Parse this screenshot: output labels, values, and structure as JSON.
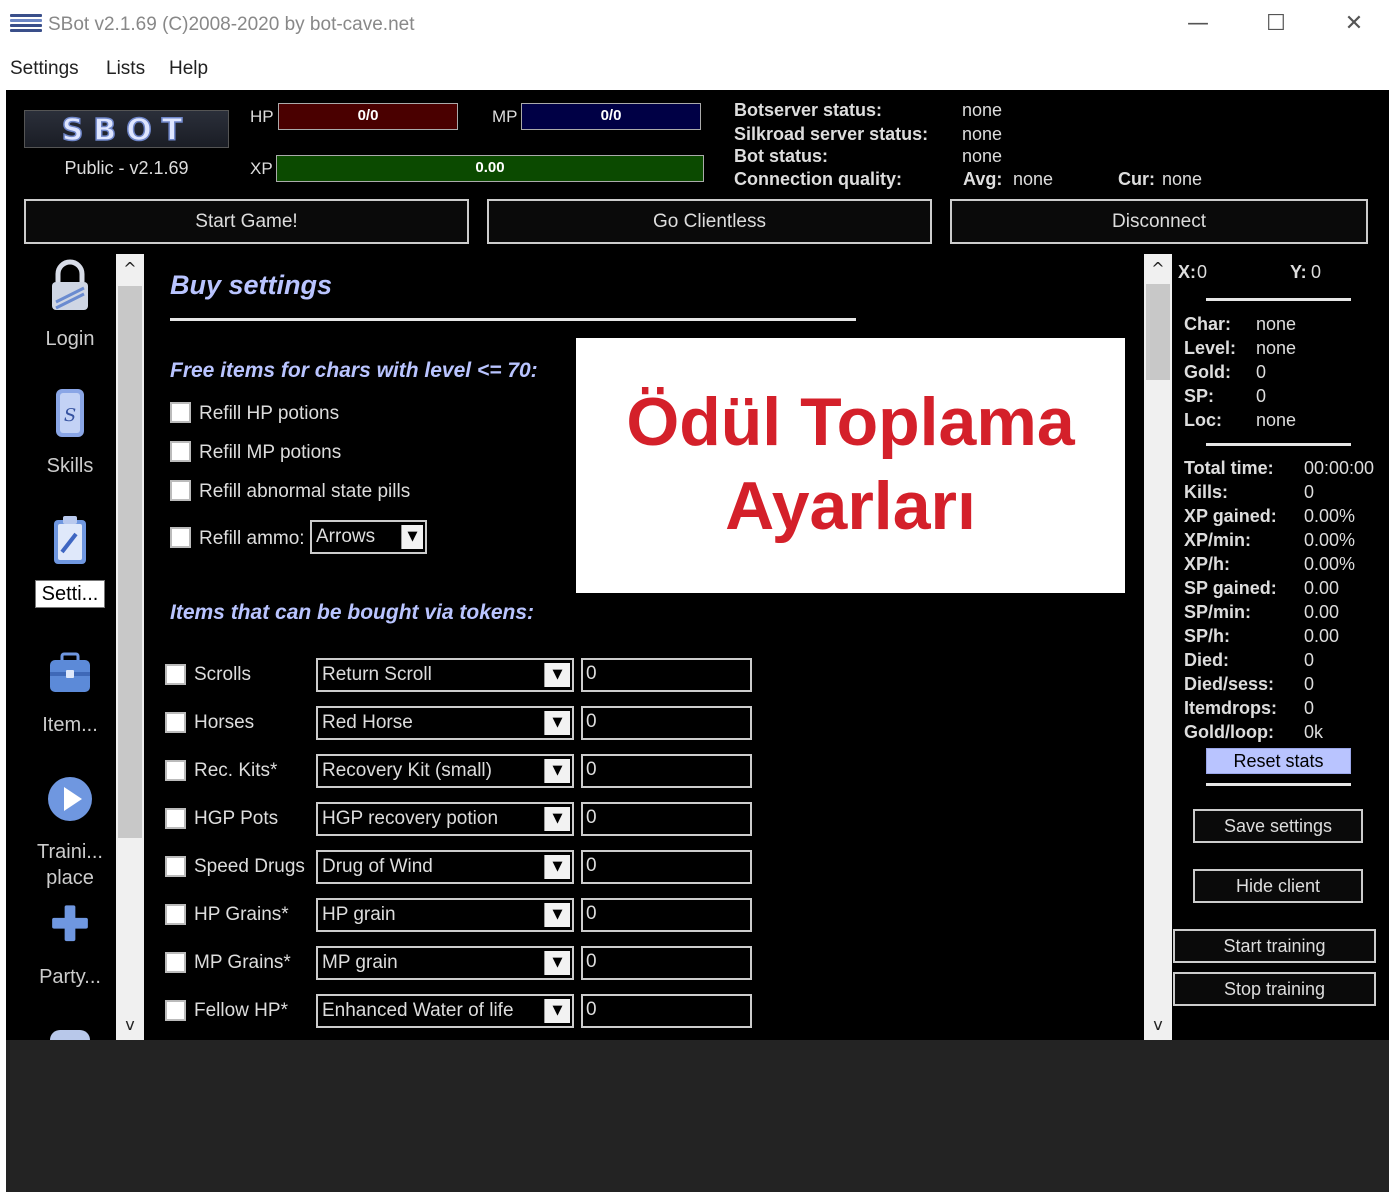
{
  "window": {
    "title": "SBot v2.1.69 (C)2008-2020 by bot-cave.net",
    "minimize": "—",
    "maximize": "☐",
    "close": "✕"
  },
  "menubar": {
    "items": [
      "Settings",
      "Lists",
      "Help"
    ]
  },
  "header": {
    "logo_text": "SBOT",
    "version": "Public - v2.1.69",
    "hp_label": "HP",
    "hp_value": "0/0",
    "mp_label": "MP",
    "mp_value": "0/0",
    "xp_label": "XP",
    "xp_value": "0.00",
    "status": {
      "botserver_label": "Botserver status:",
      "botserver_value": "none",
      "silkroad_label": "Silkroad server status:",
      "silkroad_value": "none",
      "bot_label": "Bot status:",
      "bot_value": "none",
      "connection_label": "Connection quality:",
      "avg_label": "Avg:",
      "avg_value": "none",
      "cur_label": "Cur:",
      "cur_value": "none"
    }
  },
  "actions": {
    "start_game": "Start Game!",
    "go_clientless": "Go Clientless",
    "disconnect": "Disconnect"
  },
  "nav": {
    "login": "Login",
    "skills": "Skills",
    "settings": "Setti...",
    "items": "Item...",
    "training_1": "Traini...",
    "training_2": "place",
    "party": "Party..."
  },
  "buy": {
    "title": "Buy settings",
    "free_section": "Free items for chars with level <= 70:",
    "free_items": [
      "Refill HP potions",
      "Refill MP potions",
      "Refill abnormal state pills",
      "Refill ammo:"
    ],
    "ammo_selected": "Arrows",
    "token_section": "Items that can be bought via tokens:",
    "token_items": [
      {
        "label": "Scrolls",
        "item": "Return Scroll",
        "qty": "0"
      },
      {
        "label": "Horses",
        "item": "Red Horse",
        "qty": "0"
      },
      {
        "label": "Rec. Kits*",
        "item": "Recovery Kit (small)",
        "qty": "0"
      },
      {
        "label": "HGP Pots",
        "item": "HGP recovery potion",
        "qty": "0"
      },
      {
        "label": "Speed Drugs",
        "item": "Drug of Wind",
        "qty": "0"
      },
      {
        "label": "HP Grains*",
        "item": "HP grain",
        "qty": "0"
      },
      {
        "label": "MP Grains*",
        "item": "MP grain",
        "qty": "0"
      },
      {
        "label": "Fellow HP*",
        "item": "Enhanced Water of life",
        "qty": "0"
      }
    ]
  },
  "overlay": {
    "line1": "Ödül Toplama",
    "line2": "Ayarları",
    "color": "#d4202a"
  },
  "side": {
    "x_label": "X:",
    "x_value": "0",
    "y_label": "Y:",
    "y_value": "0",
    "char_info": [
      {
        "label": "Char:",
        "value": "none"
      },
      {
        "label": "Level:",
        "value": "none"
      },
      {
        "label": "Gold:",
        "value": "0"
      },
      {
        "label": "SP:",
        "value": "0"
      },
      {
        "label": "Loc:",
        "value": "none"
      }
    ],
    "stats": [
      {
        "label": "Total time:",
        "value": "00:00:00"
      },
      {
        "label": "Kills:",
        "value": "0"
      },
      {
        "label": "XP gained:",
        "value": "0.00%"
      },
      {
        "label": "XP/min:",
        "value": "0.00%"
      },
      {
        "label": "XP/h:",
        "value": "0.00%"
      },
      {
        "label": "SP gained:",
        "value": "0.00"
      },
      {
        "label": "SP/min:",
        "value": "0.00"
      },
      {
        "label": "SP/h:",
        "value": "0.00"
      },
      {
        "label": "Died:",
        "value": "0"
      },
      {
        "label": "Died/sess:",
        "value": "0"
      },
      {
        "label": "Itemdrops:",
        "value": "0"
      },
      {
        "label": "Gold/loop:",
        "value": "0k"
      }
    ],
    "reset_stats": "Reset stats",
    "save_settings": "Save settings",
    "hide_client": "Hide client",
    "start_training": "Start training",
    "stop_training": "Stop training"
  },
  "colors": {
    "accent": "#b9c4ff",
    "hp_bar": "#4a0000",
    "mp_bar": "#000045",
    "xp_bar": "#0b4a00"
  }
}
